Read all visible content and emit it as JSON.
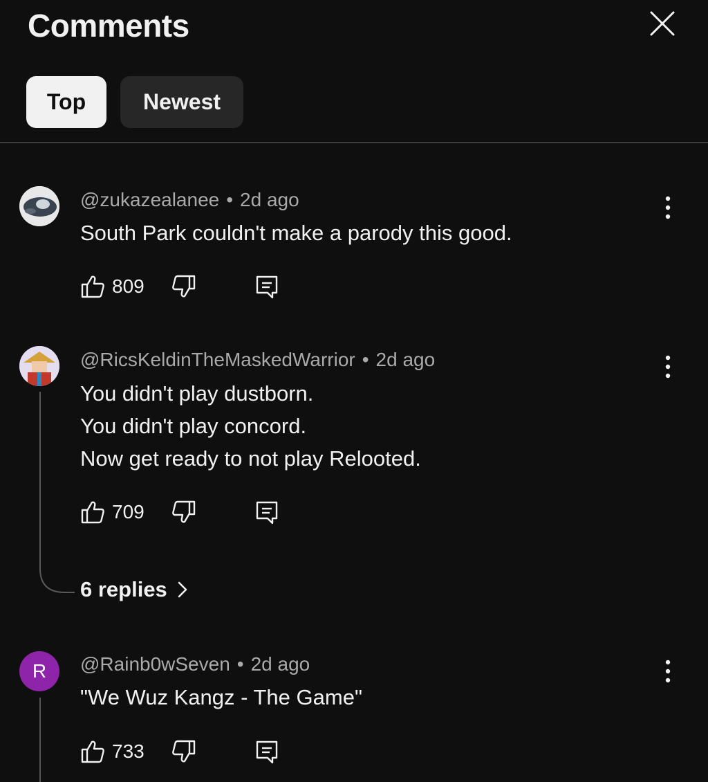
{
  "header": {
    "title": "Comments"
  },
  "tabs": [
    {
      "label": "Top",
      "active": true
    },
    {
      "label": "Newest",
      "active": false
    }
  ],
  "comments": [
    {
      "author": "@zukazealanee",
      "time": "2d ago",
      "lines": [
        "South Park couldn't make a parody this good."
      ],
      "likes": "809"
    },
    {
      "author": "@RicsKeldinTheMaskedWarrior",
      "time": "2d ago",
      "lines": [
        "You didn't play dustborn.",
        "You didn't play concord.",
        "Now get ready to not play Relooted."
      ],
      "likes": "709",
      "replies_label": "6 replies"
    },
    {
      "author": "@Rainb0wSeven",
      "time": "2d ago",
      "lines": [
        "\"We Wuz Kangz - The Game\""
      ],
      "likes": "733",
      "avatar_letter": "R",
      "avatar_color": "#8e24aa"
    }
  ],
  "separator": "•",
  "icons": {
    "close": "close-icon",
    "like": "thumbs-up-icon",
    "dislike": "thumbs-down-icon",
    "reply": "reply-icon",
    "more": "more-vert-icon",
    "chevron": "chevron-right-icon"
  }
}
